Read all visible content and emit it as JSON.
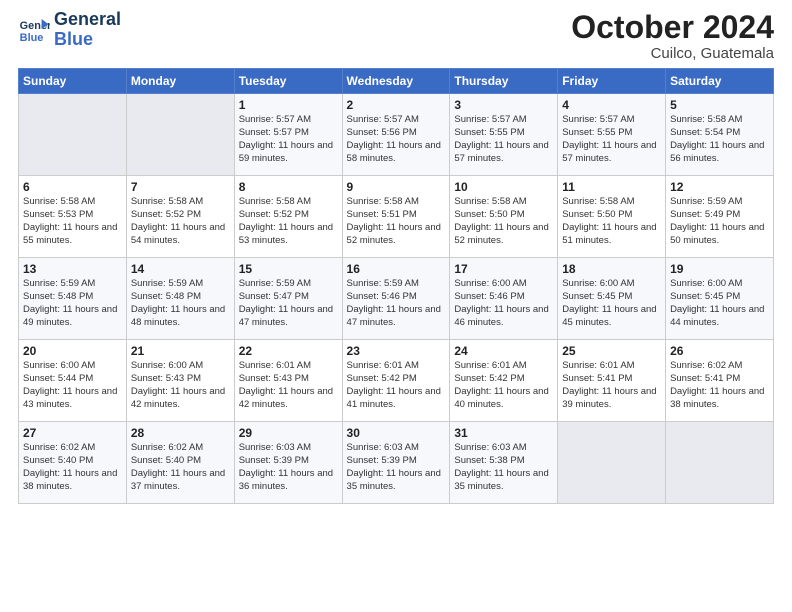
{
  "logo": {
    "line1": "General",
    "line2": "Blue"
  },
  "title": "October 2024",
  "subtitle": "Cuilco, Guatemala",
  "header_days": [
    "Sunday",
    "Monday",
    "Tuesday",
    "Wednesday",
    "Thursday",
    "Friday",
    "Saturday"
  ],
  "weeks": [
    [
      {
        "day": "",
        "info": ""
      },
      {
        "day": "",
        "info": ""
      },
      {
        "day": "1",
        "info": "Sunrise: 5:57 AM\nSunset: 5:57 PM\nDaylight: 11 hours and 59 minutes."
      },
      {
        "day": "2",
        "info": "Sunrise: 5:57 AM\nSunset: 5:56 PM\nDaylight: 11 hours and 58 minutes."
      },
      {
        "day": "3",
        "info": "Sunrise: 5:57 AM\nSunset: 5:55 PM\nDaylight: 11 hours and 57 minutes."
      },
      {
        "day": "4",
        "info": "Sunrise: 5:57 AM\nSunset: 5:55 PM\nDaylight: 11 hours and 57 minutes."
      },
      {
        "day": "5",
        "info": "Sunrise: 5:58 AM\nSunset: 5:54 PM\nDaylight: 11 hours and 56 minutes."
      }
    ],
    [
      {
        "day": "6",
        "info": "Sunrise: 5:58 AM\nSunset: 5:53 PM\nDaylight: 11 hours and 55 minutes."
      },
      {
        "day": "7",
        "info": "Sunrise: 5:58 AM\nSunset: 5:52 PM\nDaylight: 11 hours and 54 minutes."
      },
      {
        "day": "8",
        "info": "Sunrise: 5:58 AM\nSunset: 5:52 PM\nDaylight: 11 hours and 53 minutes."
      },
      {
        "day": "9",
        "info": "Sunrise: 5:58 AM\nSunset: 5:51 PM\nDaylight: 11 hours and 52 minutes."
      },
      {
        "day": "10",
        "info": "Sunrise: 5:58 AM\nSunset: 5:50 PM\nDaylight: 11 hours and 52 minutes."
      },
      {
        "day": "11",
        "info": "Sunrise: 5:58 AM\nSunset: 5:50 PM\nDaylight: 11 hours and 51 minutes."
      },
      {
        "day": "12",
        "info": "Sunrise: 5:59 AM\nSunset: 5:49 PM\nDaylight: 11 hours and 50 minutes."
      }
    ],
    [
      {
        "day": "13",
        "info": "Sunrise: 5:59 AM\nSunset: 5:48 PM\nDaylight: 11 hours and 49 minutes."
      },
      {
        "day": "14",
        "info": "Sunrise: 5:59 AM\nSunset: 5:48 PM\nDaylight: 11 hours and 48 minutes."
      },
      {
        "day": "15",
        "info": "Sunrise: 5:59 AM\nSunset: 5:47 PM\nDaylight: 11 hours and 47 minutes."
      },
      {
        "day": "16",
        "info": "Sunrise: 5:59 AM\nSunset: 5:46 PM\nDaylight: 11 hours and 47 minutes."
      },
      {
        "day": "17",
        "info": "Sunrise: 6:00 AM\nSunset: 5:46 PM\nDaylight: 11 hours and 46 minutes."
      },
      {
        "day": "18",
        "info": "Sunrise: 6:00 AM\nSunset: 5:45 PM\nDaylight: 11 hours and 45 minutes."
      },
      {
        "day": "19",
        "info": "Sunrise: 6:00 AM\nSunset: 5:45 PM\nDaylight: 11 hours and 44 minutes."
      }
    ],
    [
      {
        "day": "20",
        "info": "Sunrise: 6:00 AM\nSunset: 5:44 PM\nDaylight: 11 hours and 43 minutes."
      },
      {
        "day": "21",
        "info": "Sunrise: 6:00 AM\nSunset: 5:43 PM\nDaylight: 11 hours and 42 minutes."
      },
      {
        "day": "22",
        "info": "Sunrise: 6:01 AM\nSunset: 5:43 PM\nDaylight: 11 hours and 42 minutes."
      },
      {
        "day": "23",
        "info": "Sunrise: 6:01 AM\nSunset: 5:42 PM\nDaylight: 11 hours and 41 minutes."
      },
      {
        "day": "24",
        "info": "Sunrise: 6:01 AM\nSunset: 5:42 PM\nDaylight: 11 hours and 40 minutes."
      },
      {
        "day": "25",
        "info": "Sunrise: 6:01 AM\nSunset: 5:41 PM\nDaylight: 11 hours and 39 minutes."
      },
      {
        "day": "26",
        "info": "Sunrise: 6:02 AM\nSunset: 5:41 PM\nDaylight: 11 hours and 38 minutes."
      }
    ],
    [
      {
        "day": "27",
        "info": "Sunrise: 6:02 AM\nSunset: 5:40 PM\nDaylight: 11 hours and 38 minutes."
      },
      {
        "day": "28",
        "info": "Sunrise: 6:02 AM\nSunset: 5:40 PM\nDaylight: 11 hours and 37 minutes."
      },
      {
        "day": "29",
        "info": "Sunrise: 6:03 AM\nSunset: 5:39 PM\nDaylight: 11 hours and 36 minutes."
      },
      {
        "day": "30",
        "info": "Sunrise: 6:03 AM\nSunset: 5:39 PM\nDaylight: 11 hours and 35 minutes."
      },
      {
        "day": "31",
        "info": "Sunrise: 6:03 AM\nSunset: 5:38 PM\nDaylight: 11 hours and 35 minutes."
      },
      {
        "day": "",
        "info": ""
      },
      {
        "day": "",
        "info": ""
      }
    ]
  ]
}
